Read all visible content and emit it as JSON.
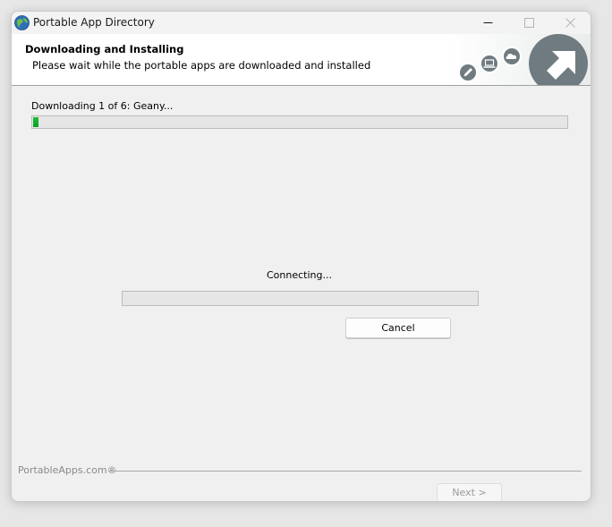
{
  "window": {
    "title": "Portable App Directory",
    "icon": "globe-icon"
  },
  "header": {
    "title": "Downloading and Installing",
    "subtitle": "Please wait while the portable apps are downloaded and installed"
  },
  "download": {
    "status_label": "Downloading 1 of 6: Geany...",
    "overall_progress_fraction": 0.01
  },
  "connection": {
    "status_label": "Connecting...",
    "progress_fraction": 0
  },
  "buttons": {
    "cancel_label": "Cancel",
    "next_label": "Next >"
  },
  "footer": {
    "brand": "PortableApps.com®"
  },
  "colors": {
    "progress_fill": "#06b025",
    "logo_gray": "#6f7b80"
  }
}
